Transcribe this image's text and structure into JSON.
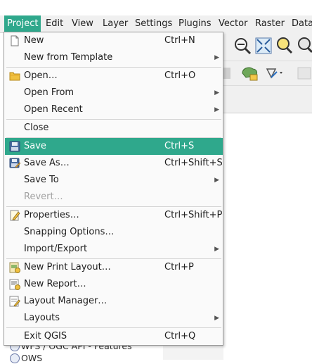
{
  "menubar": {
    "items": [
      {
        "label": "Project"
      },
      {
        "label": "Edit"
      },
      {
        "label": "View"
      },
      {
        "label": "Layer"
      },
      {
        "label": "Settings"
      },
      {
        "label": "Plugins"
      },
      {
        "label": "Vector"
      },
      {
        "label": "Raster"
      },
      {
        "label": "Datal"
      }
    ]
  },
  "project_menu": {
    "items": [
      {
        "label": "New",
        "shortcut": "Ctrl+N",
        "icon": "new-file-icon"
      },
      {
        "label": "New from Template",
        "shortcut": "",
        "submenu": true
      },
      {
        "label": "Open…",
        "shortcut": "Ctrl+O",
        "icon": "folder-icon"
      },
      {
        "label": "Open From",
        "shortcut": "",
        "submenu": true
      },
      {
        "label": "Open Recent",
        "shortcut": "",
        "submenu": true
      },
      {
        "label": "Close",
        "shortcut": ""
      },
      {
        "label": "Save",
        "shortcut": "Ctrl+S",
        "icon": "save-icon",
        "highlighted": true
      },
      {
        "label": "Save As…",
        "shortcut": "Ctrl+Shift+S",
        "icon": "save-as-icon"
      },
      {
        "label": "Save To",
        "shortcut": "",
        "submenu": true
      },
      {
        "label": "Revert…",
        "shortcut": "",
        "disabled": true
      },
      {
        "label": "Properties…",
        "shortcut": "Ctrl+Shift+P",
        "icon": "properties-icon"
      },
      {
        "label": "Snapping Options…",
        "shortcut": ""
      },
      {
        "label": "Import/Export",
        "shortcut": "",
        "submenu": true
      },
      {
        "label": "New Print Layout…",
        "shortcut": "Ctrl+P",
        "icon": "print-layout-icon"
      },
      {
        "label": "New Report…",
        "shortcut": "",
        "icon": "report-icon"
      },
      {
        "label": "Layout Manager…",
        "shortcut": "",
        "icon": "layout-manager-icon"
      },
      {
        "label": "Layouts",
        "shortcut": "",
        "submenu": true
      },
      {
        "label": "Exit QGIS",
        "shortcut": "Ctrl+Q"
      }
    ]
  },
  "browser_tree": {
    "items": [
      {
        "label": "WFS / OGC API - Features"
      },
      {
        "label": "OWS"
      }
    ]
  },
  "colors": {
    "accent": "#2fa88c",
    "menu_bg": "#fafafa"
  }
}
